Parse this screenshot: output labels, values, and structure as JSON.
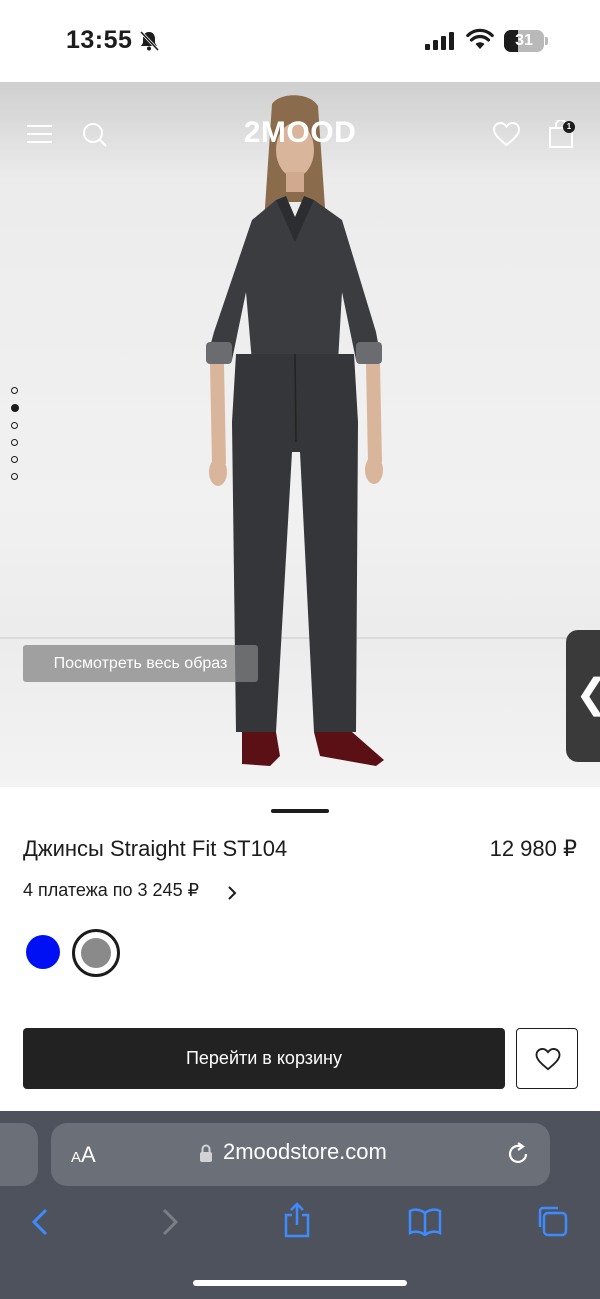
{
  "status_bar": {
    "time": "13:55",
    "battery_level": "31"
  },
  "header": {
    "logo": "2MOOD",
    "cart_count": "1",
    "icons": [
      "menu-icon",
      "search-icon",
      "heart-icon",
      "shopping-bag-icon"
    ]
  },
  "gallery": {
    "slide_count": 6,
    "active_slide": 2,
    "outfit_button_label": "Посмотреть весь образ",
    "side_tab_glyph": "❮"
  },
  "product": {
    "name": "Джинсы Straight Fit ST104",
    "price": "12 980 ₽",
    "installments": "4 платежа по 3 245 ₽",
    "colors": [
      {
        "name": "blue",
        "hex": "#0010f5",
        "selected": false
      },
      {
        "name": "grey",
        "hex": "#8a8a8a",
        "selected": true
      }
    ]
  },
  "actions": {
    "cart_button_label": "Перейти в корзину"
  },
  "browser": {
    "text_size_label_small": "A",
    "text_size_label_large": "A",
    "url": "2moodstore.com",
    "toolbar_icons": [
      "back-icon",
      "forward-icon",
      "share-icon",
      "bookmarks-icon",
      "tabs-icon"
    ]
  },
  "colors": {
    "accent_dark": "#222222",
    "safari_bar": "#4e525c"
  }
}
